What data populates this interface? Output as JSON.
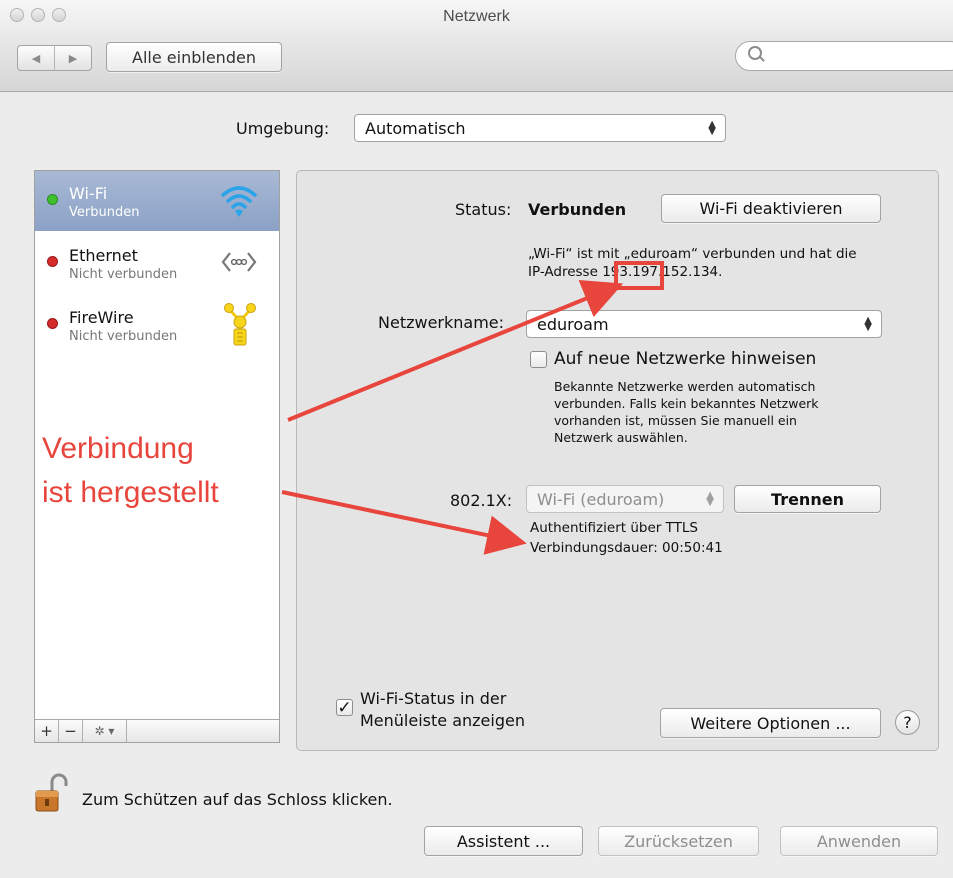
{
  "window": {
    "title": "Netzwerk"
  },
  "toolbar": {
    "back_glyph": "◀",
    "forward_glyph": "▶",
    "show_all_label": "Alle einblenden",
    "search_placeholder": ""
  },
  "location": {
    "label": "Umgebung:",
    "value": "Automatisch"
  },
  "services": [
    {
      "name": "Wi-Fi",
      "status": "Verbunden",
      "indicator": "#3fc12e",
      "icon": "wifi-icon",
      "selected": true
    },
    {
      "name": "Ethernet",
      "status": "Nicht verbunden",
      "indicator": "#d42b2b",
      "icon": "ethernet-icon",
      "selected": false
    },
    {
      "name": "FireWire",
      "status": "Nicht verbunden",
      "indicator": "#d42b2b",
      "icon": "firewire-icon",
      "selected": false
    }
  ],
  "sidebar_toolbar": {
    "add": "+",
    "remove": "−",
    "action": "✲ ▾"
  },
  "detail": {
    "status_label": "Status:",
    "status_value": "Verbunden",
    "toggle_wifi_label": "Wi-Fi deaktivieren",
    "status_desc_line1": "„Wi-Fi“ ist mit „eduroam“ verbunden und hat die",
    "status_desc_line2": "IP-Adresse 193.197.152.134.",
    "network_name_label": "Netzwerkname:",
    "network_name_value": "eduroam",
    "ask_join_label": "Auf neue Netzwerke hinweisen",
    "ask_join_desc": [
      "Bekannte Netzwerke werden automatisch",
      "verbunden. Falls kein bekanntes Netzwerk",
      "vorhanden ist, müssen Sie manuell ein",
      "Netzwerk auswählen."
    ],
    "dot1x_label": "802.1X:",
    "dot1x_value": "Wi-Fi (eduroam)",
    "disconnect_label": "Trennen",
    "auth_line": "Authentifiziert über TTLS",
    "duration_line": "Verbindungsdauer: 00:50:41",
    "menubar_label_line1": "Wi-Fi-Status in der",
    "menubar_label_line2": "Menüleiste anzeigen",
    "menubar_checked": true,
    "advanced_label": "Weitere Optionen ...",
    "help_label": "?"
  },
  "lock_text": "Zum Schützen auf das Schloss klicken.",
  "footer": {
    "assist": "Assistent ...",
    "revert": "Zurücksetzen",
    "apply": "Anwenden"
  },
  "annotation": {
    "line1": "Verbindung",
    "line2": "ist hergestellt",
    "color": "#e8453c"
  }
}
